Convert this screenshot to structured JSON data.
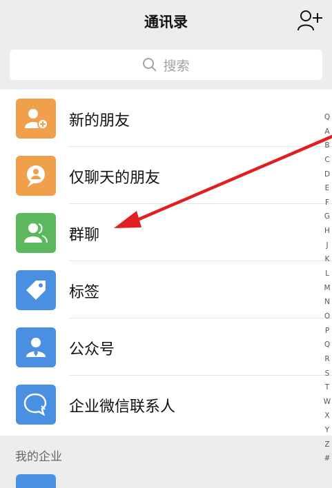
{
  "header": {
    "title": "通讯录",
    "add_contact_icon": "add-contact-icon"
  },
  "search": {
    "placeholder": "搜索",
    "icon": "search-icon"
  },
  "items": [
    {
      "label": "新的朋友",
      "icon": "new-friends-icon",
      "color": "#f0a04b"
    },
    {
      "label": "仅聊天的朋友",
      "icon": "chat-only-friends-icon",
      "color": "#f0a04b"
    },
    {
      "label": "群聊",
      "icon": "group-chat-icon",
      "color": "#5cb85c"
    },
    {
      "label": "标签",
      "icon": "tag-icon",
      "color": "#4a90e2"
    },
    {
      "label": "公众号",
      "icon": "official-account-icon",
      "color": "#4a90e2"
    },
    {
      "label": "企业微信联系人",
      "icon": "work-contacts-icon",
      "color": "#4a90e2"
    }
  ],
  "section": {
    "title": "我的企业"
  },
  "index_letters": [
    "Q",
    "A",
    "B",
    "C",
    "D",
    "E",
    "F",
    "G",
    "H",
    "J",
    "K",
    "L",
    "M",
    "N",
    "O",
    "P",
    "Q",
    "R",
    "S",
    "T",
    "W",
    "X",
    "Y",
    "Z",
    "#"
  ],
  "annotation": {
    "color": "#e02020",
    "points_to": "群聊"
  }
}
